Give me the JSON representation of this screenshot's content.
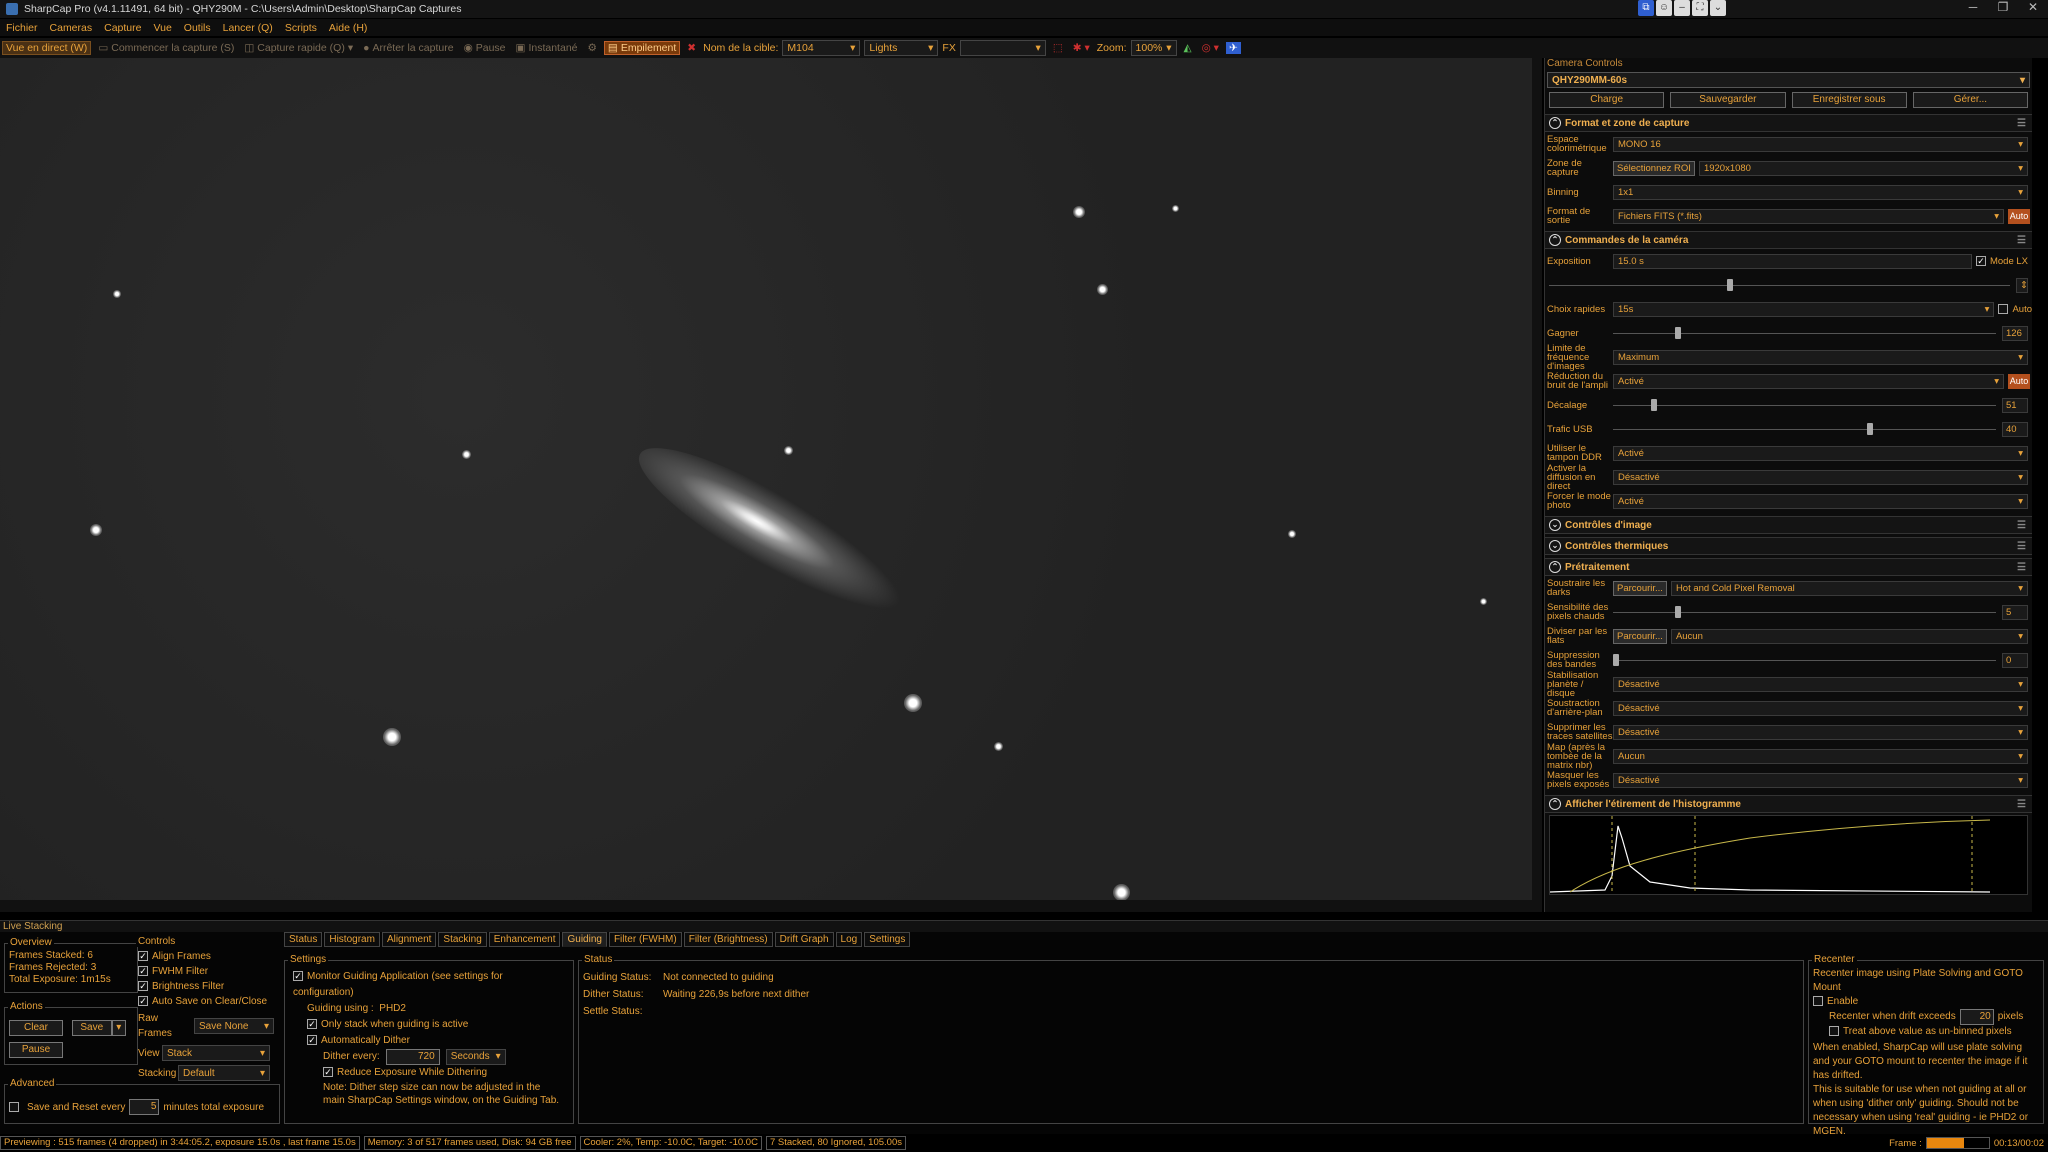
{
  "window": {
    "title": "SharpCap Pro (v4.1.11491, 64 bit) - QHY290M - C:\\Users\\Admin\\Desktop\\SharpCap Captures",
    "controls": [
      "─",
      "❐",
      "✕"
    ]
  },
  "menu": [
    "Fichier",
    "Cameras",
    "Capture",
    "Vue",
    "Outils",
    "Lancer (Q)",
    "Scripts",
    "Aide (H)"
  ],
  "toolbar": {
    "live_view": "Vue en direct (W)",
    "start_capture": "Commencer la capture (S)",
    "quick_capture": "Capture rapide (Q)",
    "stop_capture": "Arrêter la capture",
    "pause": "Pause",
    "snapshot": "Instantané",
    "stacking": "Empilement",
    "target_label": "Nom de la cible:",
    "target_value": "M104",
    "frame_type": "Lights",
    "fx_label": "FX",
    "zoom_label": "Zoom:",
    "zoom_value": "100%"
  },
  "camera_panel": {
    "header": "Camera Controls",
    "camera": "QHY290MM-60s",
    "profile_buttons": [
      "Charge",
      "Sauvegarder",
      "Enregistrer sous",
      "Gérer..."
    ],
    "format_section": {
      "title": "Format et zone de capture",
      "colorspace_label": "Espace colorimétrique",
      "colorspace": "MONO 16",
      "area_label": "Zone de capture",
      "roi_button": "Sélectionnez ROI",
      "area": "1920x1080",
      "binning_label": "Binning",
      "binning": "1x1",
      "output_label": "Format de sortie",
      "output": "Fichiers FITS (*.fits)",
      "auto": "Auto"
    },
    "camera_section": {
      "title": "Commandes de la caméra",
      "exposure_label": "Exposition",
      "exposure": "15.0 s",
      "lx_mode": "Mode LX",
      "quick_label": "Choix rapides",
      "quick": "15s",
      "quick_auto": "Auto",
      "gain_label": "Gagner",
      "gain": "126",
      "framerate_label": "Limite de fréquence d'images",
      "framerate": "Maximum",
      "ampnoise_label": "Réduction du bruit de l'ampli",
      "ampnoise": "Activé",
      "offset_label": "Décalage",
      "offset": "51",
      "usb_label": "Trafic USB",
      "usb": "40",
      "ddr_label": "Utiliser le tampon DDR",
      "ddr": "Activé",
      "broadcast_label": "Activer la diffusion en direct",
      "broadcast": "Désactivé",
      "photo_label": "Forcer le mode photo",
      "photo": "Activé"
    },
    "sections_collapsed": [
      "Contrôles d'image",
      "Contrôles thermiques"
    ],
    "preprocess_section": {
      "title": "Prétraitement",
      "darks_label": "Soustraire les darks",
      "browse": "Parcourir...",
      "darks": "Hot and Cold Pixel Removal",
      "hot_label": "Sensibilité des pixels chauds",
      "hot": "5",
      "flats_label": "Diviser par les flats",
      "flats": "Aucun",
      "banding_label": "Suppression des bandes",
      "banding": "0",
      "planet_label": "Stabilisation planète / disque",
      "planet": "Désactivé",
      "bg_label": "Soustraction d'arrière-plan",
      "bg": "Désactivé",
      "sat_label": "Supprimer les traces satellites",
      "sat": "Désactivé",
      "matrix_label": "Map (après la tombée de la matrix nbr)",
      "matrix": "Aucun",
      "mask_label": "Masquer les pixels exposés",
      "mask": "Désactivé"
    },
    "histogram_section": {
      "title": "Afficher l'étirement de l'histogramme"
    }
  },
  "live_stacking": {
    "title": "Live Stacking",
    "overview": {
      "title": "Overview",
      "stacked_label": "Frames Stacked:",
      "stacked": "6",
      "rejected_label": "Frames Rejected:",
      "rejected": "3",
      "exposure_label": "Total Exposure:",
      "exposure": "1m15s"
    },
    "actions": {
      "title": "Actions",
      "clear": "Clear",
      "save": "Save",
      "pause": "Pause"
    },
    "advanced": {
      "title": "Advanced",
      "save_reset": "Save and Reset every",
      "minutes": "minutes total exposure",
      "value": "5"
    },
    "controls": {
      "title": "Controls",
      "align": "Align Frames",
      "fwhm": "FWHM Filter",
      "brightness": "Brightness Filter",
      "autosave": "Auto Save on Clear/Close",
      "raw_label": "Raw Frames",
      "raw": "Save None",
      "view_label": "View",
      "view": "Stack",
      "stacking_label": "Stacking",
      "stacking": "Default"
    },
    "tabs": [
      "Status",
      "Histogram",
      "Alignment",
      "Stacking",
      "Enhancement",
      "Guiding",
      "Filter (FWHM)",
      "Filter (Brightness)",
      "Drift Graph",
      "Log",
      "Settings"
    ],
    "active_tab": "Guiding",
    "settings": {
      "title": "Settings",
      "monitor": "Monitor Guiding Application (see settings for configuration)",
      "using_label": "Guiding using :",
      "using": "PHD2",
      "only_stack": "Only stack when guiding is active",
      "auto_dither": "Automatically Dither",
      "dither_label": "Dither every:",
      "dither_value": "720",
      "dither_unit": "Seconds",
      "reduce": "Reduce Exposure While Dithering",
      "note": "Note: Dither step size can now be adjusted in the main SharpCap Settings window, on the Guiding Tab."
    },
    "status": {
      "title": "Status",
      "guiding_label": "Guiding Status:",
      "guiding": "Not connected to guiding",
      "dither_label": "Dither Status:",
      "dither": "Waiting 226,9s before next dither",
      "settle_label": "Settle Status:"
    },
    "recenter": {
      "title": "Recenter",
      "desc": "Recenter image using Plate Solving and GOTO Mount",
      "enable": "Enable",
      "drift_label": "Recenter when drift exceeds",
      "drift": "20",
      "pixels": "pixels",
      "unbinned": "Treat above value as un-binned pixels",
      "info": "When enabled, SharpCap will use plate solving and your GOTO mount to recenter the image if it has drifted.",
      "info2": "This is suitable for use when not guiding at all or when using 'dither only' guiding. Should not be necessary when using 'real' guiding - ie PHD2 or MGEN."
    }
  },
  "statusbar": {
    "preview": "Previewing : 515 frames (4 dropped) in 3:44:05.2, exposure 15.0s , last frame 15.0s",
    "memory": "Memory: 3 of 517 frames used, Disk: 94 GB free",
    "cooler": "Cooler: 2%, Temp: -10.0C, Target: -10.0C",
    "stacked": "7 Stacked, 80 Ignored, 105.00s",
    "frame_label": "Frame :",
    "frame_progress": 0.6,
    "frame_time": "00:13/00:02"
  },
  "colors": {
    "accent": "#e8a23a",
    "auto_button": "#b4501e",
    "background": "#000000"
  }
}
